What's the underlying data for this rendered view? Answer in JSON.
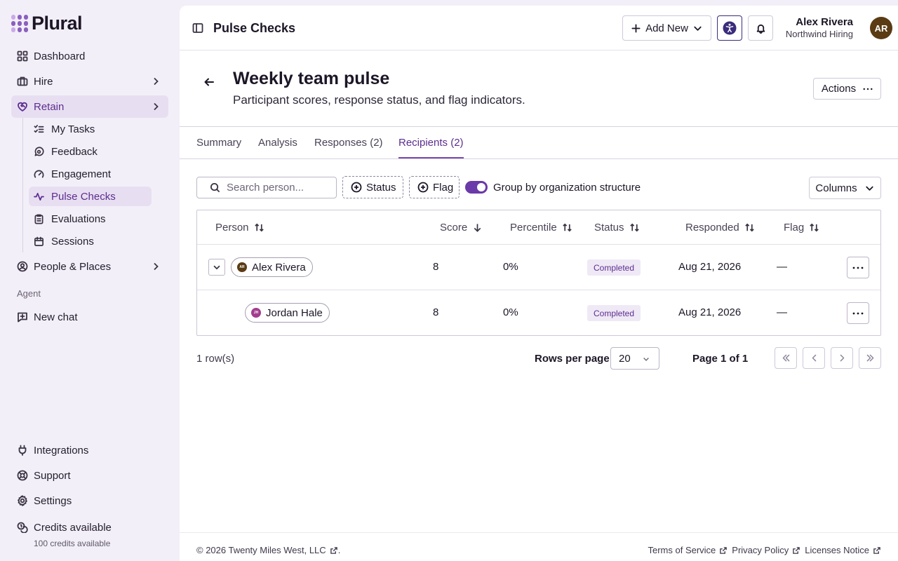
{
  "app": {
    "logo_text": "Plural"
  },
  "sidebar": {
    "items": [
      {
        "label": "Dashboard"
      },
      {
        "label": "Hire"
      },
      {
        "label": "Retain"
      },
      {
        "label": "People & Places"
      }
    ],
    "retain_subitems": [
      {
        "label": "My Tasks"
      },
      {
        "label": "Feedback"
      },
      {
        "label": "Engagement"
      },
      {
        "label": "Pulse Checks"
      },
      {
        "label": "Evaluations"
      },
      {
        "label": "Sessions"
      }
    ],
    "agent_section": "Agent",
    "new_chat": "New chat",
    "bottom": [
      {
        "label": "Integrations"
      },
      {
        "label": "Support"
      },
      {
        "label": "Settings"
      },
      {
        "label": "Credits available"
      }
    ],
    "credits_sub": "100 credits available"
  },
  "topbar": {
    "title": "Pulse Checks",
    "add_new": "Add New",
    "user_name": "Alex Rivera",
    "user_org": "Northwind Hiring",
    "avatar_initials": "AR"
  },
  "header": {
    "title": "Weekly team pulse",
    "subtitle": "Participant scores, response status, and flag indicators.",
    "actions_label": "Actions"
  },
  "tabs": [
    {
      "label": "Summary"
    },
    {
      "label": "Analysis"
    },
    {
      "label": "Responses (2)"
    },
    {
      "label": "Recipients (2)"
    }
  ],
  "active_tab": "Recipients (2)",
  "filters": {
    "search_placeholder": "Search person...",
    "status": "Status",
    "flag": "Flag",
    "group_toggle_label": "Group by organization structure",
    "group_toggle_on": true,
    "columns": "Columns"
  },
  "table": {
    "columns": [
      "Person",
      "Score",
      "Percentile",
      "Status",
      "Responded",
      "Flag"
    ],
    "rows": [
      {
        "person": "Alex Rivera",
        "initials": "AR",
        "avatar_color": "#5a3b14",
        "score": "8",
        "percentile": "0%",
        "status": "Completed",
        "responded": "Aug 21, 2026",
        "flag": "—"
      },
      {
        "person": "Jordan Hale",
        "initials": "JH",
        "avatar_color": "#a33d8e",
        "score": "8",
        "percentile": "0%",
        "status": "Completed",
        "responded": "Aug 21, 2026",
        "flag": "—"
      }
    ]
  },
  "pagination": {
    "rows_count": "1 row(s)",
    "rows_per_page_label": "Rows per page",
    "rows_per_page": "20",
    "page_info": "Page 1 of 1"
  },
  "footer": {
    "copyright": "© 2026 Twenty Miles West, LLC",
    "copyright_suffix": ".",
    "terms": "Terms of Service",
    "privacy": "Privacy Policy",
    "licenses": "Licenses Notice"
  },
  "colors": {
    "accent": "#5d2d8f",
    "active_bg": "#e7dff1",
    "sidebar_bg": "#f3eff8"
  }
}
